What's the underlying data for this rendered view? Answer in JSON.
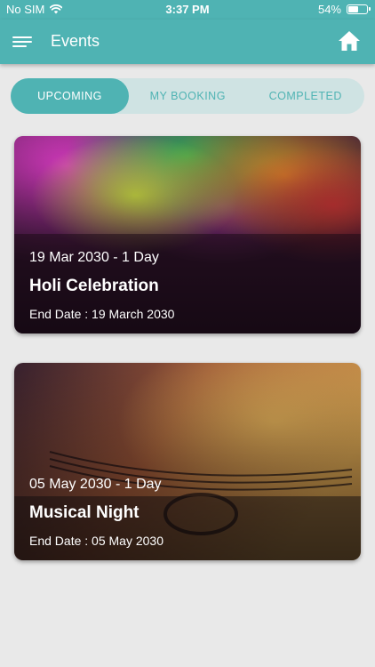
{
  "status_bar": {
    "carrier": "No SIM",
    "time": "3:37 PM",
    "battery": "54%"
  },
  "app_bar": {
    "title": "Events",
    "menu_icon": "menu-icon",
    "home_icon": "home-icon"
  },
  "tabs": [
    {
      "label": "UPCOMING",
      "active": true
    },
    {
      "label": "MY BOOKING",
      "active": false
    },
    {
      "label": "COMPLETED",
      "active": false
    }
  ],
  "events": [
    {
      "date": "19 Mar 2030 - 1 Day",
      "title": "Holi Celebration",
      "end_date": "End Date : 19 March 2030"
    },
    {
      "date": "05 May 2030 - 1 Day",
      "title": "Musical Night",
      "end_date": "End Date : 05 May 2030"
    }
  ],
  "colors": {
    "primary": "#4fb3b3",
    "tab_track": "#cfe3e3",
    "background": "#e9e9e9"
  }
}
